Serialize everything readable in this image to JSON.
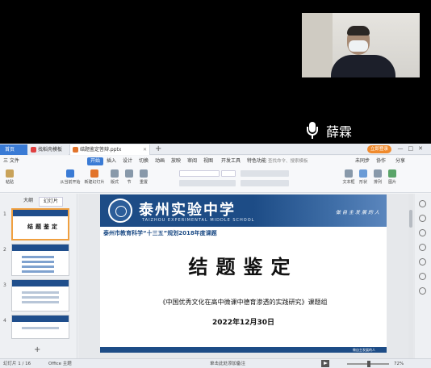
{
  "video": {
    "participant_name": "薛霖",
    "mic_icon": "microphone-icon"
  },
  "window": {
    "tabs": [
      {
        "label": "首页"
      },
      {
        "label": "找稻壳模板"
      },
      {
        "label": "结题鉴定答辩.pptx"
      }
    ],
    "login_label": "立即登录",
    "colors": {
      "accent": "#3a7bd5",
      "banner": "#1d4c86",
      "login": "#f08a2c"
    }
  },
  "menu": {
    "file": "三 文件",
    "items": [
      "开始",
      "插入",
      "设计",
      "切换",
      "动画",
      "放映",
      "审阅",
      "视图",
      "开发工具",
      "特色功能"
    ],
    "search_placeholder": "查找命令、搜索模板",
    "right_items": [
      "未同步",
      "协作",
      "分享"
    ]
  },
  "toolbar": {
    "buttons": [
      "粘贴",
      "从当前开始",
      "新建幻灯片",
      "版式",
      "节",
      "重置",
      "文本框",
      "形状",
      "排列",
      "图片"
    ]
  },
  "left_panel": {
    "tabs": [
      "大纲",
      "幻灯片"
    ],
    "thumb_numbers": [
      "1",
      "2",
      "3",
      "4"
    ],
    "thumb1_title": "结题鉴定",
    "add_label": "+"
  },
  "slide": {
    "school_cn": "泰州实验中学",
    "school_en": "TAIZHOU EXPERIMENTAL MIDDLE SCHOOL",
    "motto": "做自主发展的人",
    "subtitle": "泰州市教育科学“十三五”规划2018年度课题",
    "title": "结题鉴定",
    "project": "《中国优秀文化在高中微课中德育渗透的实践研究》课题组",
    "date": "2022年12月30日",
    "footer": "做自主发展的人"
  },
  "status": {
    "slide_info": "幻灯片 1 / 16",
    "theme": "Office 主题",
    "note": "单击此处添加备注",
    "zoom": "72%"
  }
}
